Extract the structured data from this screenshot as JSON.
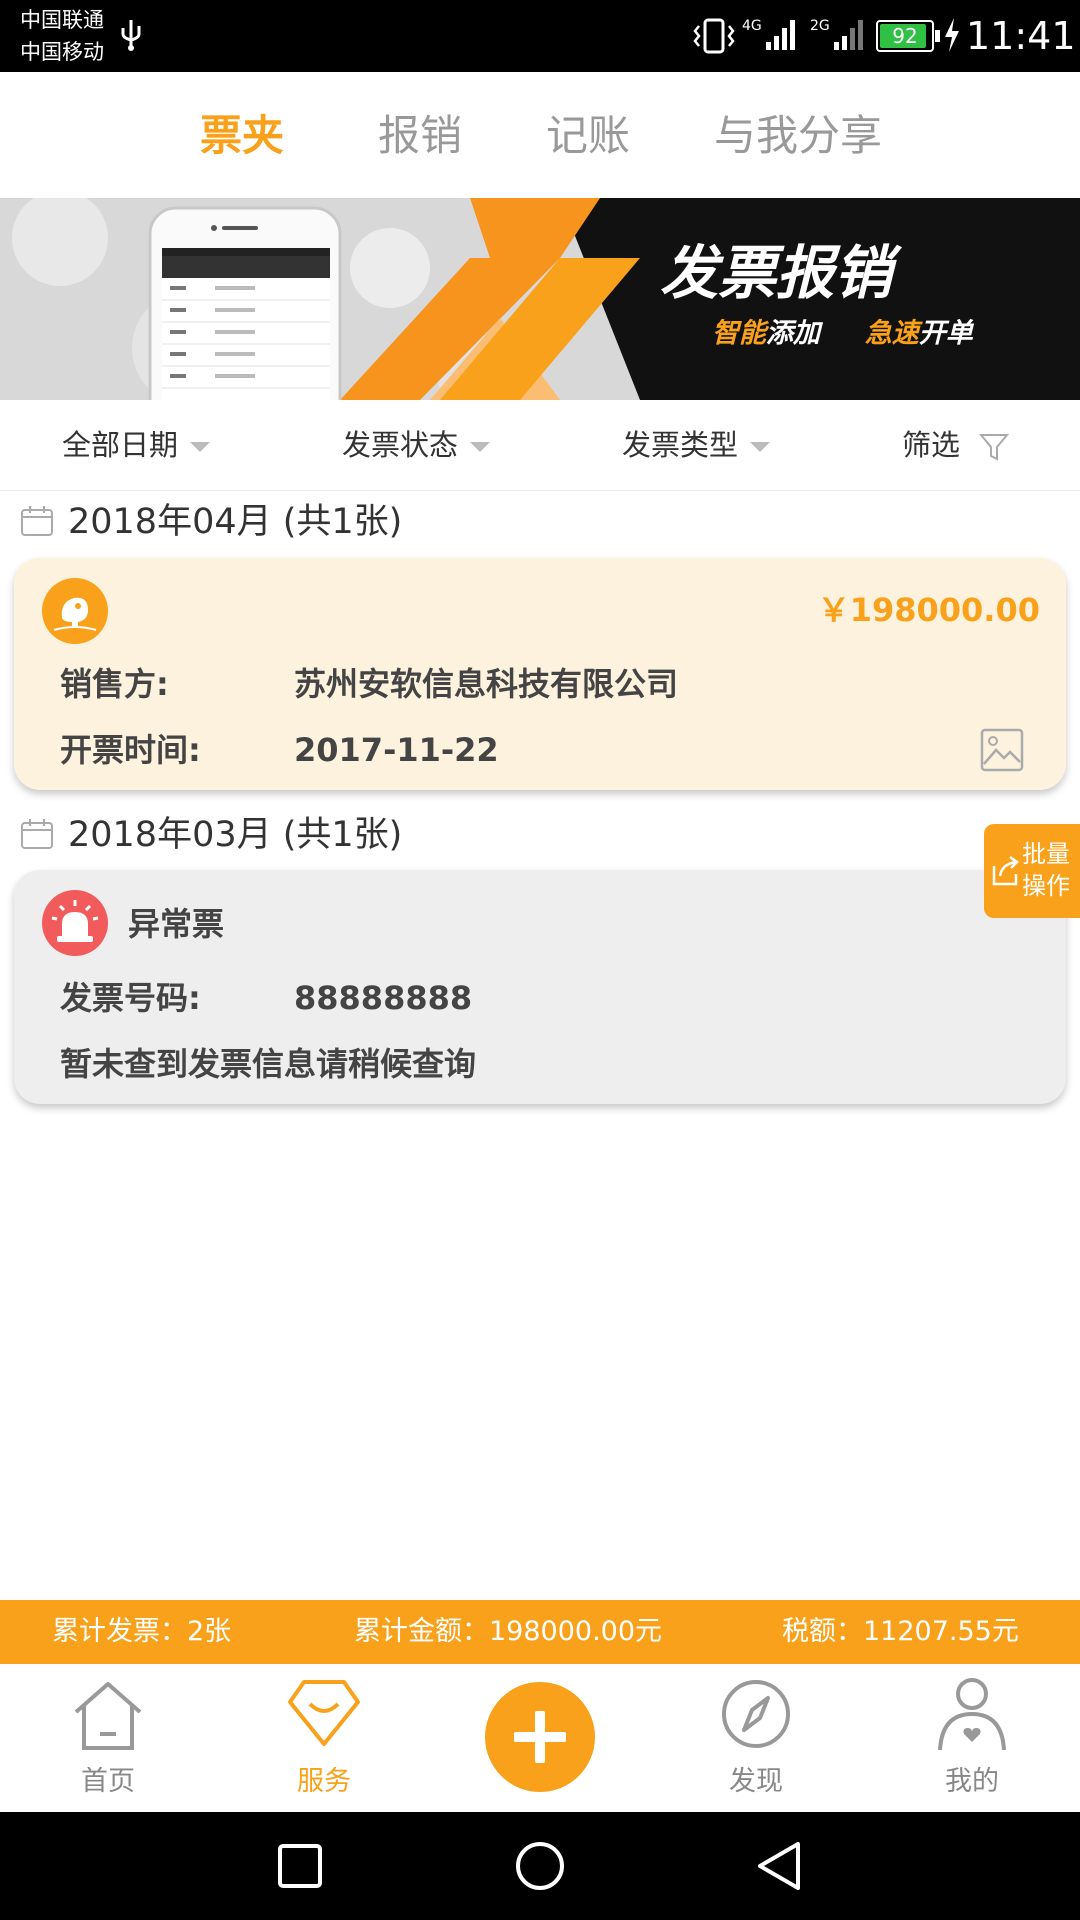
{
  "status_bar": {
    "carrier1": "中国联通",
    "carrier2": "中国移动",
    "network1": "4G",
    "network2": "2G",
    "battery": "92",
    "time": "11:41"
  },
  "tabs": [
    {
      "label": "票夹",
      "active": true
    },
    {
      "label": "报销",
      "active": false
    },
    {
      "label": "记账",
      "active": false
    },
    {
      "label": "与我分享",
      "active": false
    }
  ],
  "banner": {
    "title": "发票报销",
    "sub1_a": "智能",
    "sub1_b": "添加",
    "sub2_a": "急速",
    "sub2_b": "开单"
  },
  "filters": {
    "date": "全部日期",
    "status": "发票状态",
    "type": "发票类型",
    "filter": "筛选"
  },
  "groups": [
    {
      "month": "2018年04月 (共1张)",
      "invoice": {
        "amount": "￥198000.00",
        "seller_label": "销售方:",
        "seller": "苏州安软信息科技有限公司",
        "date_label": "开票时间:",
        "date": "2017-11-22"
      }
    },
    {
      "month": "2018年03月 (共1张)",
      "invoice": {
        "title": "异常票",
        "number_label": "发票号码:",
        "number": "88888888",
        "message": "暂未查到发票信息请稍候查询"
      }
    }
  ],
  "batch_button": {
    "line1": "批量",
    "line2": "操作"
  },
  "summary": {
    "count": "累计发票：2张",
    "amount": "累计金额：198000.00元",
    "tax": "税额：11207.55元"
  },
  "bottom_nav": [
    {
      "label": "首页",
      "icon": "home-icon",
      "active": false
    },
    {
      "label": "服务",
      "icon": "diamond-icon",
      "active": true
    },
    {
      "label": "",
      "icon": "plus-icon",
      "active": false
    },
    {
      "label": "发现",
      "icon": "compass-icon",
      "active": false
    },
    {
      "label": "我的",
      "icon": "user-icon",
      "active": false
    }
  ],
  "colors": {
    "accent": "#f9a11a",
    "invoice_card_bg": "#fdf2de",
    "abnormal_card_bg": "#eeeeee",
    "alert_red": "#f25b5b",
    "battery_green": "#2fc044"
  }
}
